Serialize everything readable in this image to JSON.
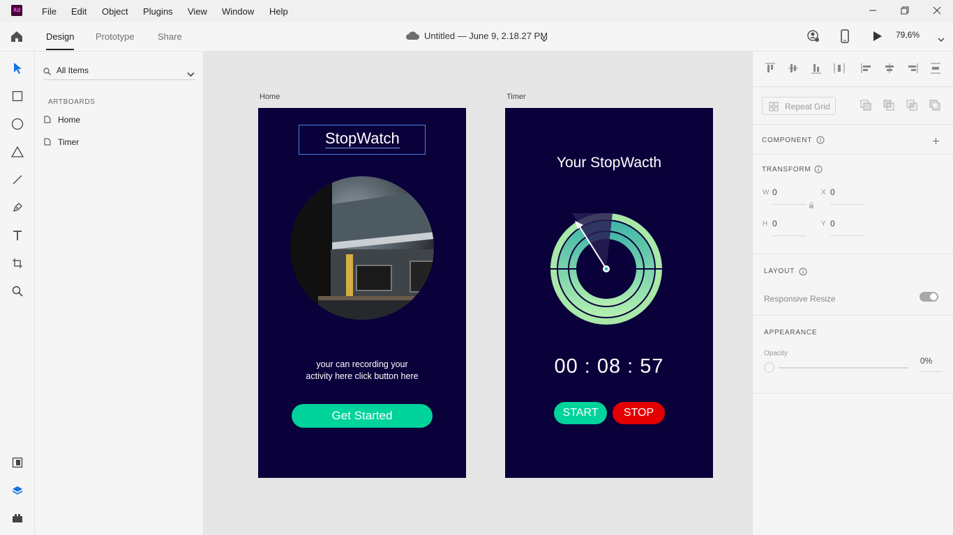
{
  "app": {
    "logo_text": "Xd"
  },
  "menu": [
    "File",
    "Edit",
    "Object",
    "Plugins",
    "View",
    "Window",
    "Help"
  ],
  "modes": {
    "design": "Design",
    "prototype": "Prototype",
    "share": "Share"
  },
  "document": {
    "title": "Untitled — June 9, 2.18.27 PM"
  },
  "zoom": "79,6%",
  "layers": {
    "search_value": "All Items",
    "artboards_heading": "ARTBOARDS",
    "items": [
      "Home",
      "Timer"
    ]
  },
  "artboards": {
    "home": {
      "label": "Home",
      "title": "StopWatch",
      "description_line1": "your can recording your",
      "description_line2": "activity here click button here",
      "button": "Get Started"
    },
    "timer": {
      "label": "Timer",
      "title": "Your StopWacth",
      "time": "00 : 08 : 57",
      "start": "START",
      "stop": "STOP"
    }
  },
  "properties": {
    "repeat_grid": "Repeat Grid",
    "component": "COMPONENT",
    "transform": "TRANSFORM",
    "w_label": "W",
    "w_value": "0",
    "x_label": "X",
    "x_value": "0",
    "h_label": "H",
    "h_value": "0",
    "y_label": "Y",
    "y_value": "0",
    "layout": "LAYOUT",
    "responsive_resize": "Responsive Resize",
    "appearance": "APPEARANCE",
    "opacity_label": "Opacity",
    "opacity_value": "0%"
  },
  "colors": {
    "artboard_bg": "#0a003a",
    "accent_green": "#00d49b",
    "stop_red": "#e30000",
    "selection_blue": "#4a7de0"
  }
}
